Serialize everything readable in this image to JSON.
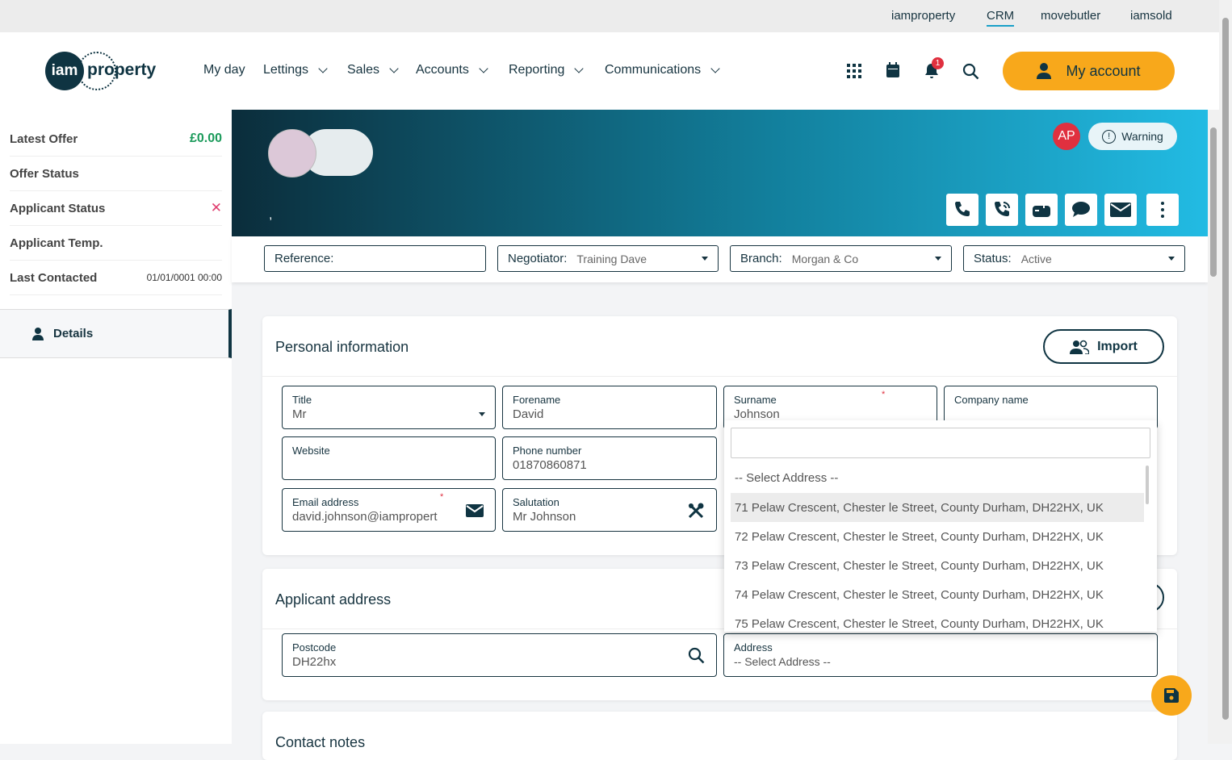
{
  "topbar": {
    "links": [
      "iamproperty",
      "CRM",
      "movebutler",
      "iamsold"
    ],
    "active": "CRM"
  },
  "logo": {
    "text_a": "iam",
    "text_b": "property"
  },
  "nav": {
    "items": [
      "My day",
      "Lettings",
      "Sales",
      "Accounts",
      "Reporting",
      "Communications"
    ]
  },
  "header": {
    "notification_count": "1",
    "my_account": "My account"
  },
  "sidebar": {
    "rows": [
      {
        "label": "Latest Offer",
        "value": "£0.00"
      },
      {
        "label": "Offer Status",
        "value": ""
      },
      {
        "label": "Applicant Status",
        "value": "✕"
      },
      {
        "label": "Applicant Temp.",
        "value": ""
      },
      {
        "label": "Last Contacted",
        "value": "01/01/0001 00:00"
      }
    ],
    "details": "Details"
  },
  "banner": {
    "name": ",",
    "avatar_initials": "AP",
    "warning": "Warning"
  },
  "filters": {
    "reference_label": "Reference:",
    "negotiator_label": "Negotiator:",
    "negotiator": "Training Dave",
    "branch_label": "Branch:",
    "branch": "Morgan & Co",
    "status_label": "Status:",
    "status": "Active"
  },
  "personal": {
    "title": "Personal information",
    "import": "Import",
    "fields": {
      "title": {
        "label": "Title",
        "value": "Mr"
      },
      "forename": {
        "label": "Forename",
        "value": "David"
      },
      "surname": {
        "label": "Surname",
        "value": "Johnson"
      },
      "company": {
        "label": "Company name",
        "value": ""
      },
      "website": {
        "label": "Website",
        "value": ""
      },
      "phone": {
        "label": "Phone number",
        "value": "01870860871"
      },
      "email": {
        "label": "Email address",
        "value": "david.johnson@iampropert"
      },
      "salutation": {
        "label": "Salutation",
        "value": "Mr Johnson"
      }
    }
  },
  "address": {
    "title": "Applicant address",
    "postcode_label": "Postcode",
    "postcode": "DH22hx",
    "address_label": "Address",
    "address": "-- Select Address --"
  },
  "dropdown": {
    "search": "",
    "options": [
      "-- Select Address --",
      "71 Pelaw Crescent, Chester le Street, County Durham, DH22HX, UK",
      "72 Pelaw Crescent, Chester le Street, County Durham, DH22HX, UK",
      "73 Pelaw Crescent, Chester le Street, County Durham, DH22HX, UK",
      "74 Pelaw Crescent, Chester le Street, County Durham, DH22HX, UK",
      "75 Pelaw Crescent, Chester le Street, County Durham, DH22HX, UK"
    ]
  },
  "notes": {
    "title": "Contact notes"
  }
}
